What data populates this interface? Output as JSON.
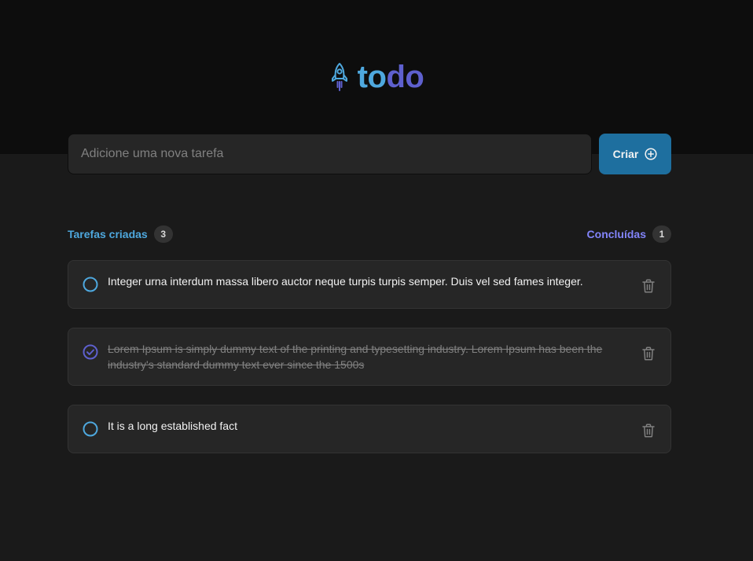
{
  "app": {
    "logo_part1": "to",
    "logo_part2": "do",
    "logo_icon": "rocket-icon"
  },
  "form": {
    "placeholder": "Adicione uma nova tarefa",
    "value": "",
    "button_label": "Criar",
    "button_icon": "plus-circle-icon"
  },
  "counters": {
    "created_label": "Tarefas criadas",
    "created_count": "3",
    "done_label": "Concluídas",
    "done_count": "1"
  },
  "tasks": [
    {
      "text": "Integer urna interdum massa libero auctor neque turpis turpis semper. Duis vel sed fames integer.",
      "done": false
    },
    {
      "text": "Lorem Ipsum is simply dummy text of the printing and typesetting industry. Lorem Ipsum has been the industry's standard dummy text ever since the 1500s",
      "done": true
    },
    {
      "text": "It is a long established fact",
      "done": false
    }
  ],
  "colors": {
    "background": "#1a1a1a",
    "header": "#0d0d0d",
    "blue": "#4ea8de",
    "blue_dark": "#1e6f9f",
    "purple": "#5e60ce",
    "purple_light": "#8284fa",
    "card": "#262626"
  }
}
